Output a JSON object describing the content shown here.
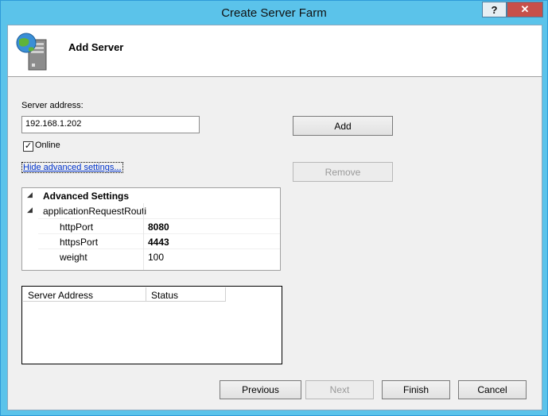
{
  "window": {
    "title": "Create Server Farm",
    "help_label": "?",
    "close_label": "✕"
  },
  "header": {
    "title": "Add Server",
    "icon": "server-globe-icon"
  },
  "form": {
    "server_address_label": "Server address:",
    "server_address_value": "192.168.1.202",
    "online_label": "Online",
    "online_checked": true,
    "advanced_link": "Hide advanced settings...",
    "add_label": "Add",
    "remove_label": "Remove"
  },
  "advanced": {
    "header": "Advanced Settings",
    "group": "applicationRequestRouti",
    "properties": [
      {
        "name": "httpPort",
        "value": "8080",
        "bold": true
      },
      {
        "name": "httpsPort",
        "value": "4443",
        "bold": true
      },
      {
        "name": "weight",
        "value": "100",
        "bold": false
      }
    ]
  },
  "servers": {
    "columns": [
      "Server Address",
      "Status"
    ],
    "rows": []
  },
  "footer": {
    "previous": "Previous",
    "next": "Next",
    "finish": "Finish",
    "cancel": "Cancel"
  }
}
